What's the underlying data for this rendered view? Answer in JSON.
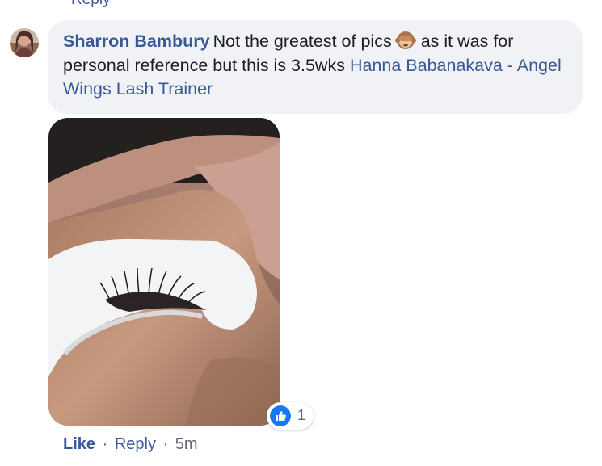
{
  "comment": {
    "author": "Sharron Bambury",
    "text_before_emoji": "Not the greatest of pics",
    "text_after_emoji": "as it was for personal reference but this is 3.5wks",
    "tagged_person": "Hanna Babanakava - Angel Wings Lash Trainer",
    "emoji_icon": "monkey-see-no-evil"
  },
  "reactions": {
    "count": "1",
    "icon": "like-thumbs-up",
    "badge_color": "#1877f2"
  },
  "actions": {
    "like_label": "Like",
    "reply_label": "Reply",
    "separator": "·",
    "timestamp": "5m"
  },
  "colors": {
    "link": "#385898",
    "bubble_bg": "#f0f2f5",
    "meta_text": "#606770"
  }
}
